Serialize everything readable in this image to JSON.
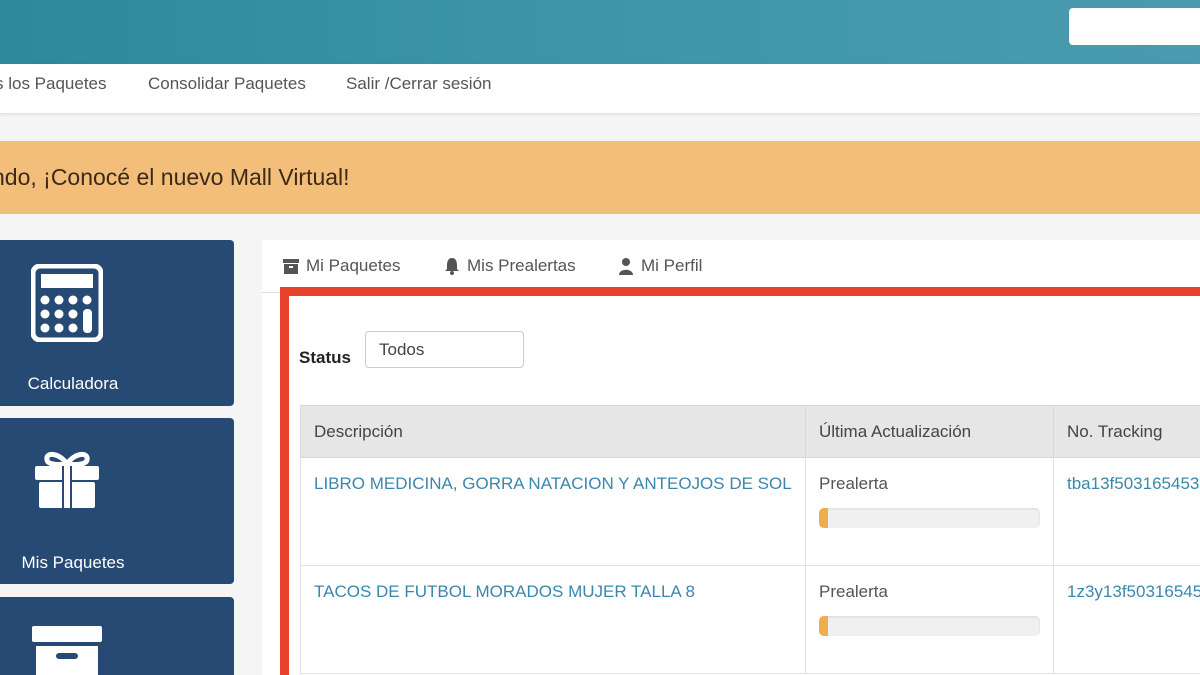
{
  "nav": {
    "items": [
      {
        "label": "s los Paquetes"
      },
      {
        "label": "Consolidar Paquetes"
      },
      {
        "label": "Salir /Cerrar sesión"
      }
    ]
  },
  "banner": {
    "text": "ndo, ¡Conocé el nuevo Mall Virtual!"
  },
  "sidebar": {
    "tiles": [
      {
        "label": "Calculadora",
        "icon": "calculator-icon"
      },
      {
        "label": "Mis Paquetes",
        "icon": "gift-icon"
      },
      {
        "label": "",
        "icon": "archive-icon"
      }
    ]
  },
  "tabs": [
    {
      "label": "Mi Paquetes",
      "icon": "archive-icon"
    },
    {
      "label": "Mis Prealertas",
      "icon": "bell-icon"
    },
    {
      "label": "Mi Perfil",
      "icon": "user-icon"
    }
  ],
  "filter": {
    "label": "Status",
    "value": "Todos"
  },
  "table": {
    "headers": [
      "Descripción",
      "Última Actualización",
      "No. Tracking"
    ],
    "rows": [
      {
        "description": "LIBRO MEDICINA, GORRA NATACION Y ANTEOJOS DE SOL",
        "status": "Prealerta",
        "progress": 0.04,
        "tracking": "tba13f503165453"
      },
      {
        "description": "TACOS DE FUTBOL MORADOS MUJER TALLA 8",
        "status": "Prealerta",
        "progress": 0.04,
        "tracking": "1z3y13f50316545"
      }
    ]
  },
  "colors": {
    "accent": "#3d96a8",
    "banner": "#f2be7a",
    "tile": "#264a73",
    "highlight": "#e8422a",
    "link": "#3a87ad",
    "progress": "#f0ad4e"
  }
}
